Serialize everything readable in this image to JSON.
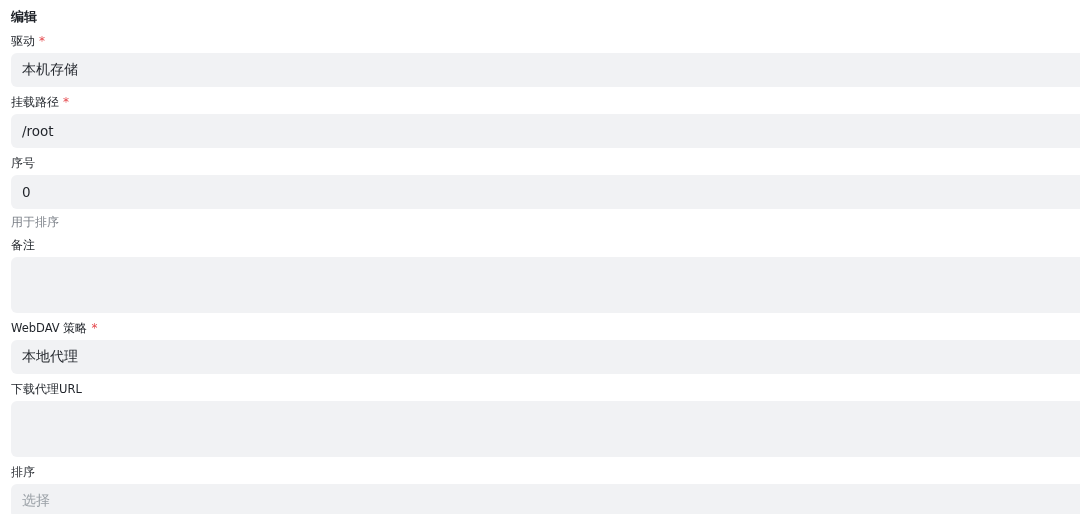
{
  "title": "编辑",
  "fields": [
    {
      "label": "驱动",
      "required_mark": "*",
      "kind": "select",
      "value": "本机存储"
    },
    {
      "label": "挂载路径",
      "required_mark": "*",
      "kind": "input",
      "value": "/root"
    },
    {
      "label": "序号",
      "kind": "input",
      "value": "0",
      "hint": "用于排序"
    },
    {
      "label": "备注",
      "kind": "textarea"
    },
    {
      "label": "WebDAV 策略",
      "required_mark": "*",
      "kind": "select",
      "value": "本地代理"
    },
    {
      "label": "下载代理URL",
      "kind": "textarea"
    },
    {
      "label": "排序",
      "kind": "select",
      "placeholder": "选择"
    }
  ]
}
